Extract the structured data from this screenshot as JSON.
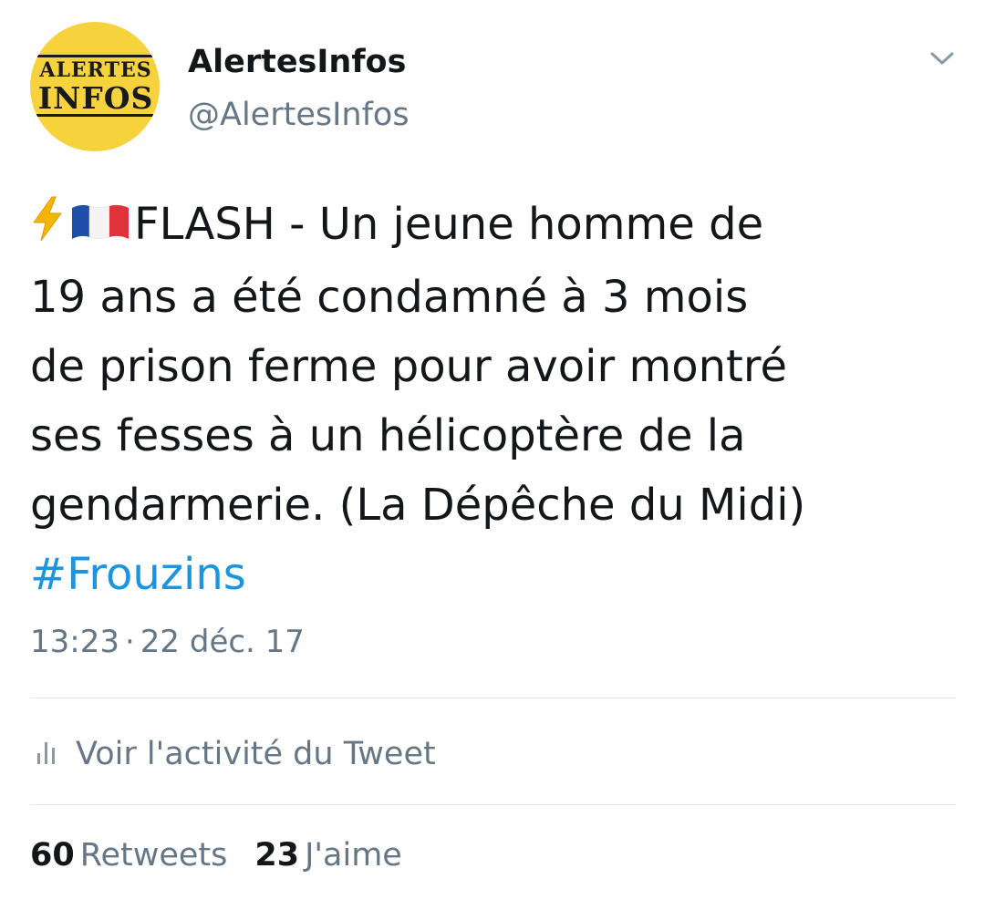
{
  "author": {
    "display_name": "AlertesInfos",
    "handle": "@AlertesInfos",
    "avatar": {
      "line1": "ALERTES",
      "line2": "INFOS",
      "background": "#f6d23c"
    }
  },
  "menu": {
    "icon": "chevron-down-icon"
  },
  "tweet": {
    "emoji": [
      "high-voltage-icon",
      "france-flag-icon"
    ],
    "lines": [
      "FLASH - Un jeune homme de",
      "19 ans a été condamné à 3 mois",
      "de prison ferme pour avoir montré",
      "ses fesses à un hélicoptère de la",
      "gendarmerie. (La Dépêche du Midi)"
    ],
    "hashtag": "#Frouzins",
    "time": "13:23",
    "separator": "·",
    "date": "22 déc. 17"
  },
  "activity": {
    "icon": "analytics-icon",
    "label": "Voir l'activité du Tweet"
  },
  "stats": {
    "retweets_count": "60",
    "retweets_label": "Retweets",
    "likes_count": "23",
    "likes_label": "J'aime"
  },
  "colors": {
    "text": "#14171a",
    "secondary": "#657786",
    "link": "#1b95e0",
    "divider": "#e1e8ed"
  }
}
